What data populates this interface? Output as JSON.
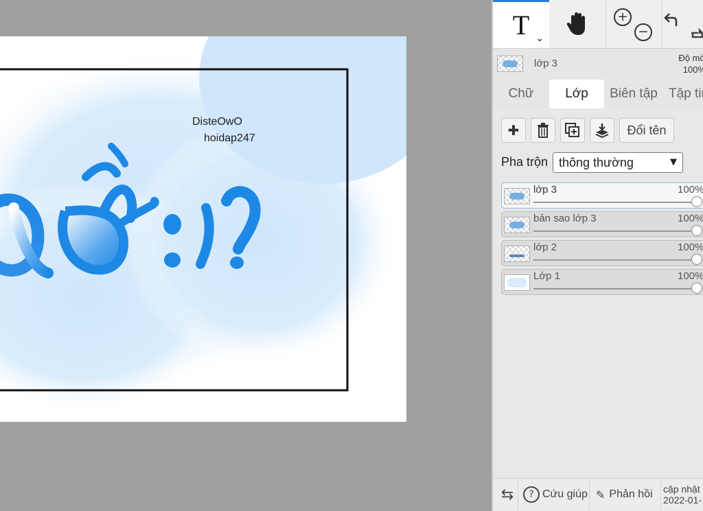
{
  "canvas": {
    "watermark_line1": "DisteOwO",
    "watermark_line2": "hoidap247",
    "accent_blue": "#1e88e5",
    "cloud_blue": "#cfe6fb"
  },
  "toolbar": {
    "text_tool_glyph": "T",
    "text_tool_chevron": "⌄",
    "tools": [
      "text-icon",
      "hand-icon",
      "zoom-in-icon",
      "zoom-out-icon",
      "undo-icon",
      "redo-icon"
    ]
  },
  "layer_info": {
    "name": "lớp 3",
    "opacity_label": "Độ mờ",
    "opacity_value": "100%"
  },
  "tabs": [
    {
      "label": "Chữ",
      "active": false
    },
    {
      "label": "Lớp",
      "active": true
    },
    {
      "label": "Biên tập",
      "active": false
    },
    {
      "label": "Tập tin",
      "active": false
    }
  ],
  "layer_actions": {
    "rename_label": "Đổi tên",
    "icons": [
      "plus-icon",
      "trash-icon",
      "duplicate-icon",
      "merge-down-icon"
    ]
  },
  "blend": {
    "label": "Pha trộn",
    "selected": "thông thường"
  },
  "layers": [
    {
      "name": "lớp 3",
      "opacity": "100%",
      "selected": true
    },
    {
      "name": "bản sao lớp 3",
      "opacity": "100%",
      "selected": false
    },
    {
      "name": "lớp 2",
      "opacity": "100%",
      "selected": false
    },
    {
      "name": "Lớp 1",
      "opacity": "100%",
      "selected": false
    }
  ],
  "footer": {
    "help_label": "Cứu giúp",
    "feedback_label": "Phản hồi",
    "update_label": "cập nhật",
    "update_date": "2022-01-"
  }
}
